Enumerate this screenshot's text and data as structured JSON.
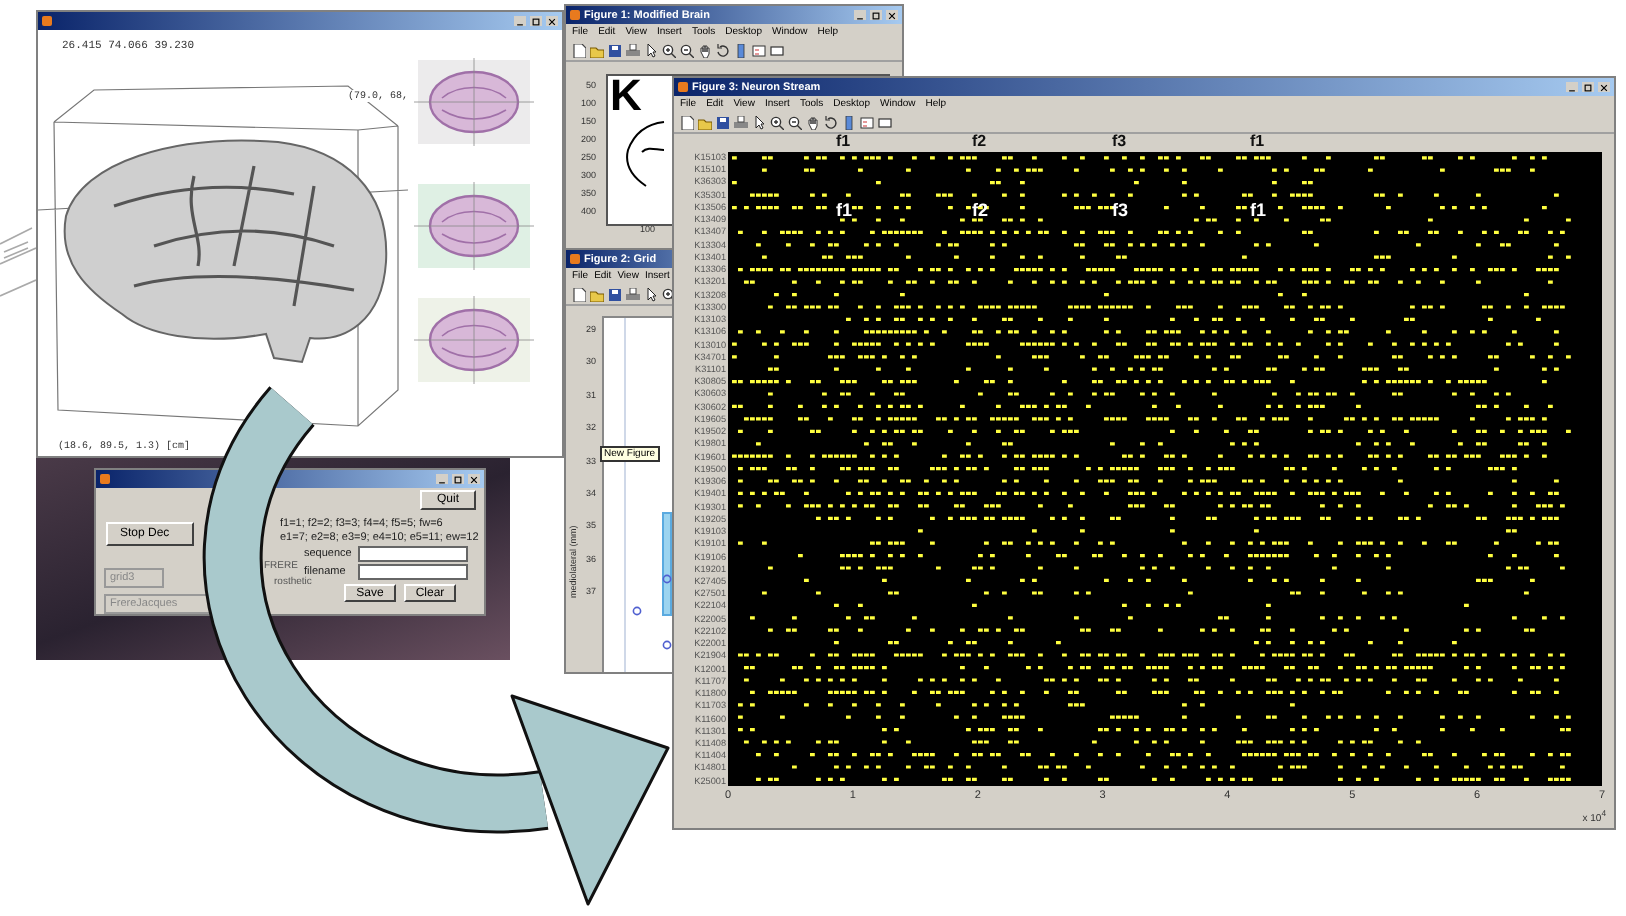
{
  "brain_viewer": {
    "coordinates": "26.415  74.066  39.230",
    "view_label": "(79.0, 68,",
    "scale_label": "(18.6, 89.5, 1.3) [cm]"
  },
  "figure_1": {
    "title": "Figure 1: Modified Brain",
    "menus": [
      "File",
      "Edit",
      "View",
      "Insert",
      "Tools",
      "Desktop",
      "Window",
      "Help"
    ],
    "letter": "K",
    "yticks": [
      "50",
      "100",
      "150",
      "200",
      "250",
      "300",
      "350",
      "400"
    ],
    "xticks": [
      "100"
    ]
  },
  "figure_2": {
    "title": "Figure 2: Grid",
    "menus": [
      "File",
      "Edit",
      "View",
      "Insert"
    ],
    "ylabel": "mediolateral (mm)",
    "yticks": [
      "29",
      "30",
      "31",
      "32",
      "33",
      "34",
      "35",
      "36",
      "37"
    ],
    "tooltip": "New Figure"
  },
  "dialog": {
    "quit": "Quit",
    "stop": "Stop Dec",
    "grid_select": "grid3",
    "song_label": "FRERE",
    "mode_label": "rosthetic",
    "song_select": "FrereJacques",
    "mapping_lines": [
      "f1=1; f2=2; f3=3; f4=4; f5=5; fw=6",
      "e1=7; e2=8; e3=9; e4=10; e5=11; ew=12"
    ],
    "fields": [
      {
        "label": "sequence"
      },
      {
        "label": "filename"
      }
    ],
    "buttons": [
      "Save",
      "Clear"
    ]
  },
  "figure_3": {
    "title": "Figure 3: Neuron Stream",
    "menus": [
      "File",
      "Edit",
      "View",
      "Insert",
      "Tools",
      "Desktop",
      "Window",
      "Help"
    ],
    "phrase_labels": [
      "f1",
      "f2",
      "f3",
      "f1"
    ],
    "inner_labels": [
      "f1",
      "f2",
      "f3",
      "f1"
    ],
    "neurons": [
      "K15103",
      "K15101",
      "K36303",
      "K35301",
      "K13506",
      "K13409",
      "K13407",
      "K13304",
      "K13401",
      "K13306",
      "K13201",
      "K13208",
      "K13300",
      "K13103",
      "K13106",
      "K13010",
      "K34701",
      "K31101",
      "K30805",
      "K30603",
      "K30602",
      "K19605",
      "K19502",
      "K19801",
      "K19601",
      "K19500",
      "K19306",
      "K19401",
      "K19301",
      "K19205",
      "K19103",
      "K19101",
      "K19106",
      "K19201",
      "K27405",
      "K27501",
      "K22104",
      "K22005",
      "K22102",
      "K22001",
      "K21904",
      "K12001",
      "K11707",
      "K11800",
      "K11703",
      "K11600",
      "K11301",
      "K11408",
      "K11404",
      "K14801",
      "K25001"
    ],
    "xticks": [
      "0",
      "1",
      "2",
      "3",
      "4",
      "5",
      "6",
      "7"
    ],
    "exponent": "x 10$^{4}$"
  }
}
